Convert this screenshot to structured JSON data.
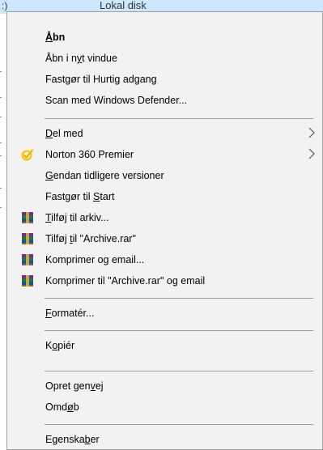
{
  "background": {
    "drive_left": ":)",
    "drive_label": "Lokal disk"
  },
  "menu": {
    "items": [
      {
        "pre": "",
        "u": "Å",
        "post": "bn"
      },
      {
        "pre": "Åbn i n",
        "u": "y",
        "post": "t vindue"
      },
      {
        "pre": "Fastgør til Hurtig adgang",
        "u": "",
        "post": ""
      },
      {
        "pre": "Scan med Windows Defender...",
        "u": "",
        "post": ""
      },
      {
        "pre": "",
        "u": "D",
        "post": "el med"
      },
      {
        "pre": "Norton 360 Premier",
        "u": "",
        "post": ""
      },
      {
        "pre": "",
        "u": "G",
        "post": "endan tidligere versioner"
      },
      {
        "pre": "Fastgør til ",
        "u": "S",
        "post": "tart"
      },
      {
        "pre": "",
        "u": "T",
        "post": "ilføj til arkiv..."
      },
      {
        "pre": "Tilføj ",
        "u": "t",
        "post": "il \"Archive.rar\""
      },
      {
        "pre": "Komprimer og email...",
        "u": "",
        "post": ""
      },
      {
        "pre": "Komprimer til \"Archive.rar\" og email",
        "u": "",
        "post": ""
      },
      {
        "pre": "",
        "u": "F",
        "post": "ormatér..."
      },
      {
        "pre": "K",
        "u": "o",
        "post": "piér"
      },
      {
        "pre": "Opret gen",
        "u": "v",
        "post": "ej"
      },
      {
        "pre": "Omd",
        "u": "ø",
        "post": "b"
      },
      {
        "pre": "Egenska",
        "u": "b",
        "post": "er"
      }
    ]
  },
  "icons": {
    "norton": "norton-checkmark-icon",
    "winrar": "winrar-archive-icon",
    "submenu": "chevron-right-icon"
  },
  "colors": {
    "menu_bg": "#f2f2f2",
    "separator": "#a0a0a0",
    "norton_yellow": "#f7c300",
    "selection_bg": "#cce8ff"
  }
}
